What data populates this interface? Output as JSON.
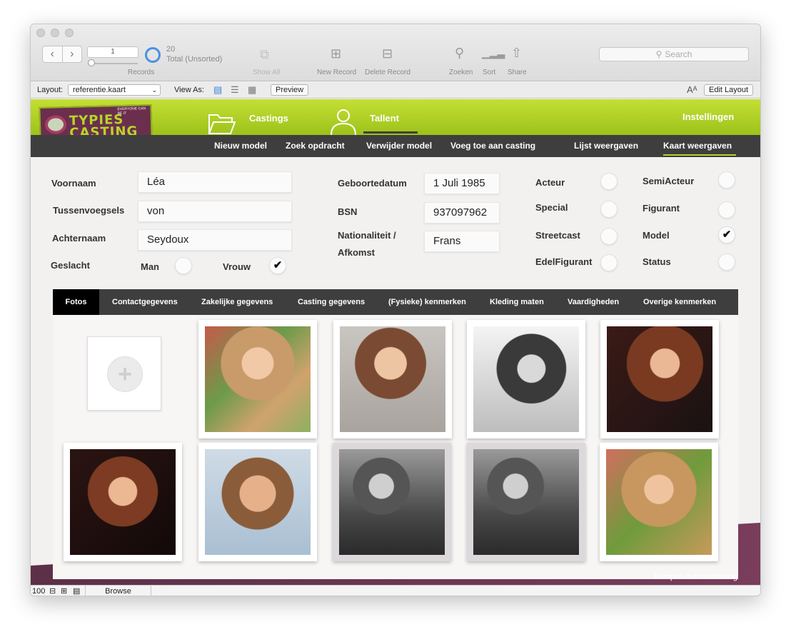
{
  "toolbar": {
    "record_number": "1",
    "records_label": "Records",
    "total_count": "20",
    "total_status": "Total (Unsorted)",
    "show_all": "Show All",
    "new_record": "New Record",
    "delete_record": "Delete Record",
    "zoeken": "Zoeken",
    "sort": "Sort",
    "share": "Share",
    "search_placeholder": "Search"
  },
  "layout_bar": {
    "layout_label": "Layout:",
    "layout_value": "referentie.kaart",
    "view_as_label": "View As:",
    "preview": "Preview",
    "font_icon_label": "Aᴬ",
    "edit_layout": "Edit Layout"
  },
  "header": {
    "logo_line1": "TYPIES",
    "logo_line2": "CASTING",
    "logo_tagline": "EVERYONE CAN BE IT",
    "nav_castings": "Castings",
    "nav_tallent": "Tallent",
    "nav_instellingen": "Instellingen"
  },
  "subnav": {
    "items": [
      "Nieuw model",
      "Zoek opdracht",
      "Verwijder model",
      "Voeg toe aan casting",
      "Lijst weergaven",
      "Kaart weergaven"
    ]
  },
  "form": {
    "voornaam_label": "Voornaam",
    "voornaam": "Léa",
    "tussenvoegsels_label": "Tussenvoegsels",
    "tussenvoegsels": "von",
    "achternaam_label": "Achternaam",
    "achternaam": "Seydoux",
    "geslacht_label": "Geslacht",
    "man_label": "Man",
    "vrouw_label": "Vrouw",
    "geboortedatum_label": "Geboortedatum",
    "geboortedatum": "1 Juli 1985",
    "bsn_label": "BSN",
    "bsn": "937097962",
    "nationaliteit_label_1": "Nationaliteit /",
    "nationaliteit_label_2": "Afkomst",
    "nationaliteit": "Frans",
    "acteur_label": "Acteur",
    "special_label": "Special",
    "streetcast_label": "Streetcast",
    "edelfigurant_label": "EdelFigurant",
    "semiacteur_label": "SemiActeur",
    "figurant_label": "Figurant",
    "model_label": "Model",
    "status_label": "Status",
    "check": "✔"
  },
  "tabs": [
    "Fotos",
    "Contactgegevens",
    "Zakelijke gegevens",
    "Casting gegevens",
    "(Fysieke) kenmerken",
    "Kleding maten",
    "Vaardigheden",
    "Overige kenmerken"
  ],
  "footer": {
    "credit": "Kempen Automatisering"
  },
  "statusbar": {
    "zoom": "100",
    "mode": "Browse"
  },
  "colors": {
    "header_green": "#b2d327",
    "nav_dark": "#3e3e3e",
    "footer_purple": "#6b3553",
    "active_tab": "#000000"
  }
}
